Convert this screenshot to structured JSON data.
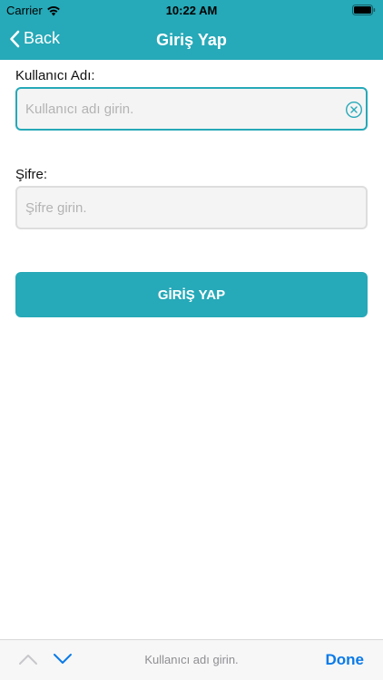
{
  "status_bar": {
    "carrier": "Carrier",
    "time": "10:22 AM"
  },
  "nav": {
    "back_label": "Back",
    "title": "Giriş Yap"
  },
  "form": {
    "username": {
      "label": "Kullanıcı Adı:",
      "placeholder": "Kullanıcı adı girin.",
      "value": ""
    },
    "password": {
      "label": "Şifre:",
      "placeholder": "Şifre girin.",
      "value": ""
    },
    "submit_label": "GİRİŞ YAP"
  },
  "toolbar": {
    "hint": "Kullanıcı adı girin.",
    "done_label": "Done"
  },
  "colors": {
    "accent": "#26a9b8",
    "done": "#0a7ae8"
  },
  "icons": {
    "back": "chevron-left-icon",
    "clear": "clear-circle-icon",
    "prev": "chevron-up-icon",
    "next": "chevron-down-icon",
    "wifi": "wifi-icon",
    "battery": "battery-icon"
  }
}
